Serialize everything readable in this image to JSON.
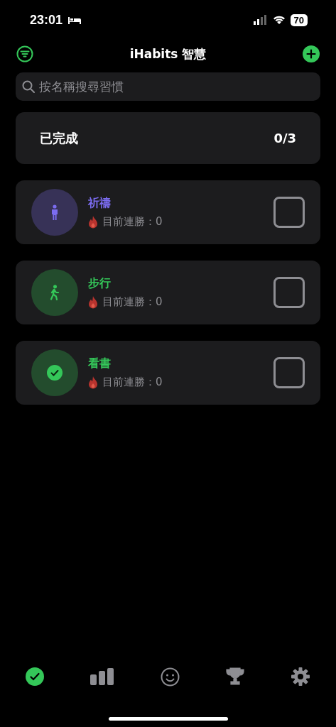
{
  "status_bar": {
    "time": "23:01",
    "battery": "70"
  },
  "header": {
    "title": "iHabits 智慧"
  },
  "search": {
    "placeholder": "按名稱搜尋習慣"
  },
  "summary": {
    "label": "已完成",
    "count": "0/3"
  },
  "habits": [
    {
      "name": "祈禱",
      "kind": "person",
      "color": "#7b6cf0",
      "streak": "目前連勝：0",
      "checked": false
    },
    {
      "name": "步行",
      "kind": "walk",
      "color": "#34c759",
      "streak": "目前連勝：0",
      "checked": false
    },
    {
      "name": "看書",
      "kind": "check",
      "color": "#34c759",
      "streak": "目前連勝：0",
      "checked": false
    }
  ],
  "tabs": [
    {
      "kind": "today",
      "selected": true
    },
    {
      "kind": "stats",
      "selected": false
    },
    {
      "kind": "mood",
      "selected": false
    },
    {
      "kind": "awards",
      "selected": false
    },
    {
      "kind": "settings",
      "selected": false
    }
  ]
}
